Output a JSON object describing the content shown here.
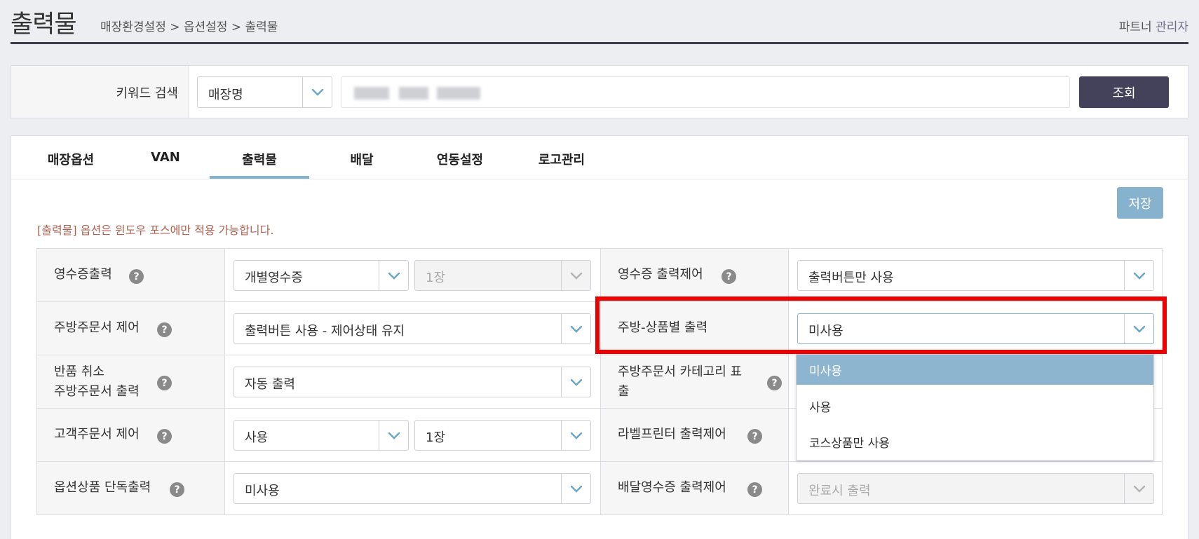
{
  "header": {
    "title": "출력물",
    "breadcrumb": "매장환경설정 > 옵션설정 > 출력물",
    "user_prefix": "파트너",
    "user_role": "관리자"
  },
  "search": {
    "label": "키워드 검색",
    "type_value": "매장명",
    "button": "조회"
  },
  "tabs": [
    {
      "label": "매장옵션"
    },
    {
      "label": "VAN"
    },
    {
      "label": "출력물"
    },
    {
      "label": "배달"
    },
    {
      "label": "연동설정"
    },
    {
      "label": "로고관리"
    }
  ],
  "active_tab": "출력물",
  "save_button": "저장",
  "notice": "[출력물] 옵션은 윈도우 포스에만 적용 가능합니다.",
  "help_glyph": "?",
  "options": {
    "receipt_print": {
      "label": "영수증출력",
      "value": "개별영수증",
      "copies": "1장"
    },
    "receipt_control": {
      "label": "영수증 출력제어",
      "value": "출력버튼만 사용"
    },
    "kitchen_control": {
      "label": "주방주문서 제어",
      "value": "출력버튼 사용 - 제어상태 유지"
    },
    "kitchen_item_print": {
      "label": "주방-상품별 출력",
      "value": "미사용"
    },
    "return_cancel": {
      "label_line1": "반품 취소",
      "label_line2": "주방주문서 출력",
      "value": "자동 출력"
    },
    "kitchen_category": {
      "label_line1": "주방주문서 카테고리 표",
      "label_line2": "출"
    },
    "customer_control": {
      "label": "고객주문서 제어",
      "value": "사용",
      "copies": "1장"
    },
    "label_printer": {
      "label": "라벨프린터 출력제어"
    },
    "option_item": {
      "label": "옵션상품 단독출력",
      "value": "미사용"
    },
    "delivery_receipt": {
      "label": "배달영수증 출력제어",
      "value": "완료시 출력"
    }
  },
  "dropdown": {
    "items": [
      "미사용",
      "사용",
      "코스상품만 사용"
    ],
    "selected": "미사용"
  },
  "colors": {
    "header_rule": "#3b3d4f",
    "search_button": "#43425a",
    "save_button": "#86b2cd",
    "tab_active": "#7fb4cb",
    "chevron": "#6aa6c4",
    "highlight": "#ee0000",
    "notice": "#b06050"
  }
}
